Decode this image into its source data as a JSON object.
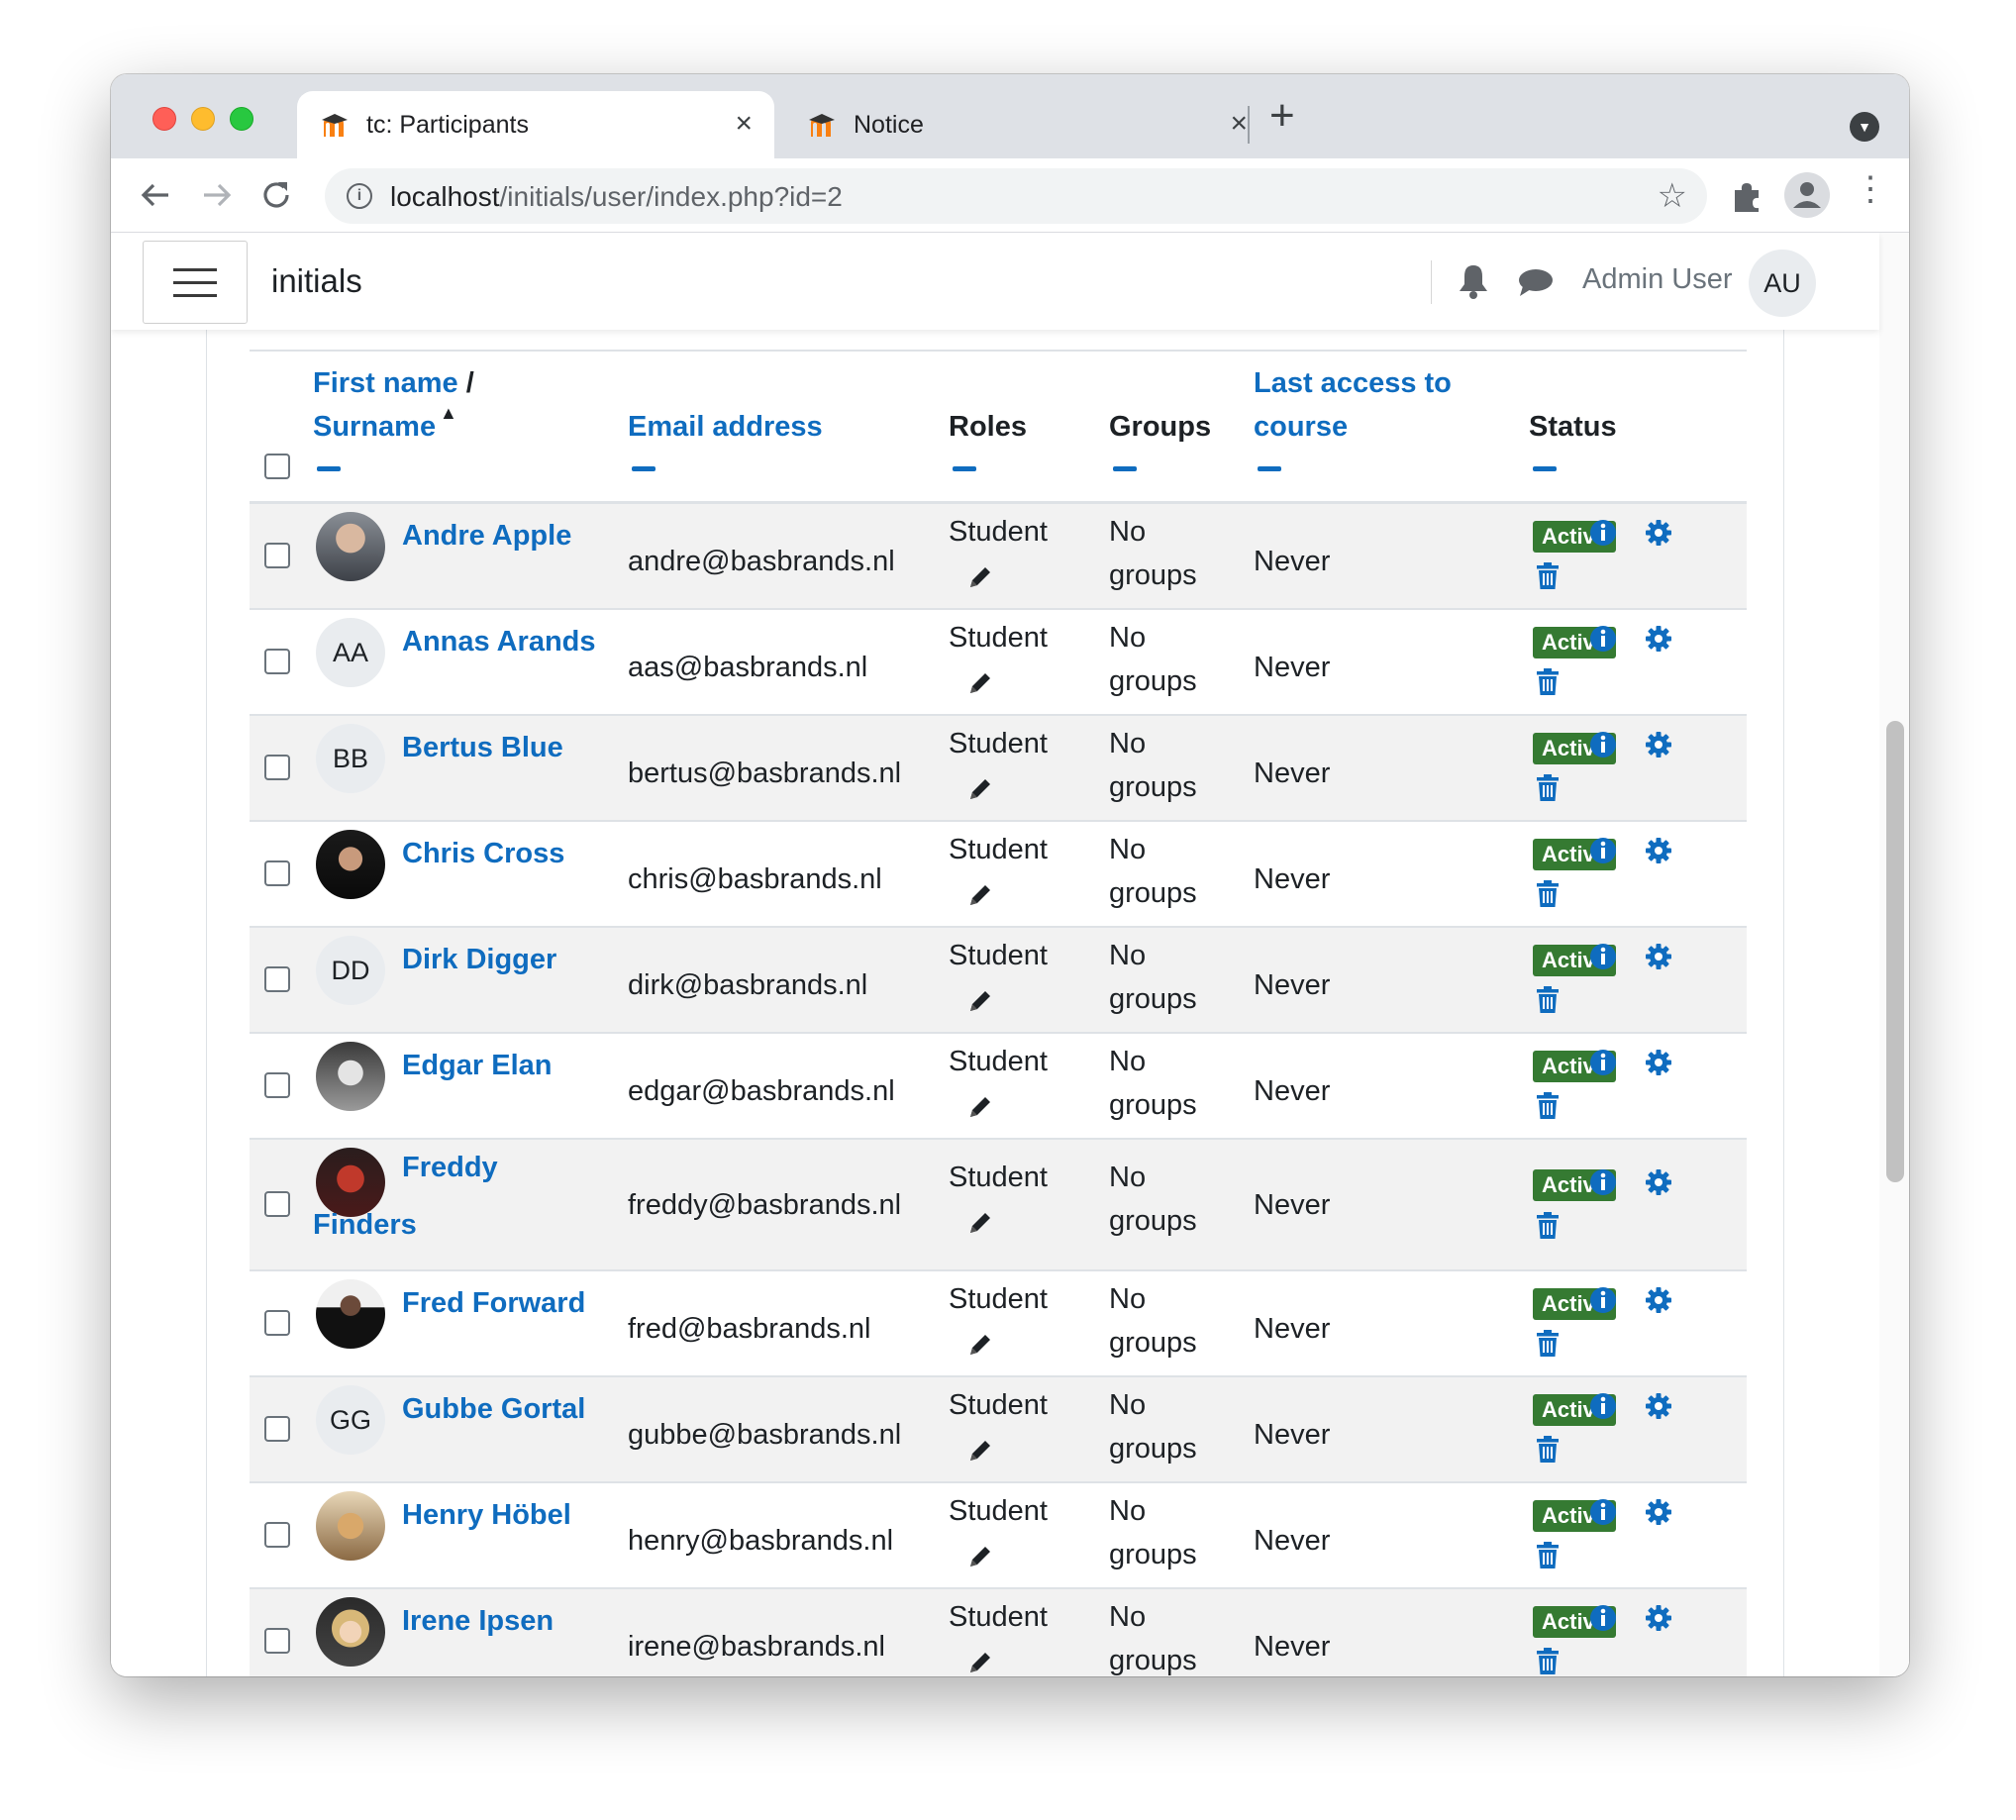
{
  "browser": {
    "tabs": [
      {
        "title": "tc: Participants",
        "active": true,
        "close": "×"
      },
      {
        "title": "Notice",
        "active": false,
        "close": "×"
      }
    ],
    "new_tab": "+",
    "url_host": "localhost",
    "url_path": "/initials/user/index.php?id=2",
    "menu_glyph": "⋮"
  },
  "navbar": {
    "site_name": "initials",
    "user_name": "Admin User",
    "user_initials": "AU"
  },
  "table": {
    "headers": {
      "first_name": "First name",
      "slash": " /",
      "surname": "Surname",
      "sort_arrow": "▲",
      "email": "Email address",
      "roles": "Roles",
      "groups": "Groups",
      "last_access_1": "Last access to",
      "last_access_2": "course",
      "status": "Status"
    },
    "rows": [
      {
        "name": "Andre Apple",
        "initials": "",
        "photo": "gray-suit",
        "email": "andre@basbrands.nl",
        "role": "Student",
        "groups_1": "No",
        "groups_2": "groups",
        "last_access": "Never",
        "status": "Active"
      },
      {
        "name": "Annas Arands",
        "initials": "AA",
        "photo": "",
        "email": "aas@basbrands.nl",
        "role": "Student",
        "groups_1": "No",
        "groups_2": "groups",
        "last_access": "Never",
        "status": "Active"
      },
      {
        "name": "Bertus Blue",
        "initials": "BB",
        "photo": "",
        "email": "bertus@basbrands.nl",
        "role": "Student",
        "groups_1": "No",
        "groups_2": "groups",
        "last_access": "Never",
        "status": "Active"
      },
      {
        "name": "Chris Cross",
        "initials": "",
        "photo": "dark",
        "email": "chris@basbrands.nl",
        "role": "Student",
        "groups_1": "No",
        "groups_2": "groups",
        "last_access": "Never",
        "status": "Active"
      },
      {
        "name": "Dirk Digger",
        "initials": "DD",
        "photo": "",
        "email": "dirk@basbrands.nl",
        "role": "Student",
        "groups_1": "No",
        "groups_2": "groups",
        "last_access": "Never",
        "status": "Active"
      },
      {
        "name": "Edgar Elan",
        "initials": "",
        "photo": "bw",
        "email": "edgar@basbrands.nl",
        "role": "Student",
        "groups_1": "No",
        "groups_2": "groups",
        "last_access": "Never",
        "status": "Active"
      },
      {
        "name": "Freddy",
        "name_line2": "Finders",
        "initials": "",
        "photo": "red",
        "email": "freddy@basbrands.nl",
        "role": "Student",
        "groups_1": "No",
        "groups_2": "groups",
        "last_access": "Never",
        "status": "Active"
      },
      {
        "name": "Fred Forward",
        "initials": "",
        "photo": "black",
        "email": "fred@basbrands.nl",
        "role": "Student",
        "groups_1": "No",
        "groups_2": "groups",
        "last_access": "Never",
        "status": "Active"
      },
      {
        "name": "Gubbe Gortal",
        "initials": "GG",
        "photo": "",
        "email": "gubbe@basbrands.nl",
        "role": "Student",
        "groups_1": "No",
        "groups_2": "groups",
        "last_access": "Never",
        "status": "Active"
      },
      {
        "name": "Henry Höbel",
        "initials": "",
        "photo": "tan",
        "email": "henry@basbrands.nl",
        "role": "Student",
        "groups_1": "No",
        "groups_2": "groups",
        "last_access": "Never",
        "status": "Active"
      },
      {
        "name": "Irene Ipsen",
        "initials": "",
        "photo": "blonde",
        "email": "irene@basbrands.nl",
        "role": "Student",
        "groups_1": "No",
        "groups_2": "groups",
        "last_access": "Never",
        "status": "Active"
      }
    ]
  },
  "colors": {
    "link": "#0f6cbf",
    "badge_active": "#357a32",
    "row_stripe": "#f2f2f2"
  },
  "icons": [
    "moodle-favicon",
    "back-arrow-icon",
    "forward-arrow-icon",
    "reload-icon",
    "info-icon",
    "star-icon",
    "puzzle-icon",
    "profile-icon",
    "kebab-menu-icon",
    "hamburger-icon",
    "bell-icon",
    "chat-icon",
    "pencil-icon",
    "info-circle-icon",
    "gear-icon",
    "trash-icon"
  ]
}
